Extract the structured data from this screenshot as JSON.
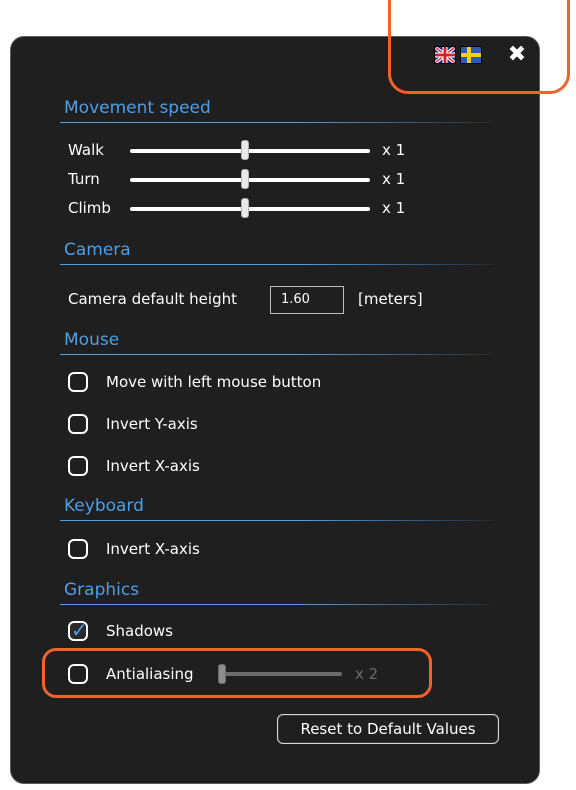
{
  "header": {
    "flags": [
      {
        "name": "uk-flag-icon",
        "language": "English"
      },
      {
        "name": "swedish-flag-icon",
        "language": "Swedish"
      }
    ],
    "close_icon": "close-icon",
    "close_glyph": "✖"
  },
  "sections": {
    "movement": {
      "title": "Movement speed",
      "rows": [
        {
          "label": "Walk",
          "multiplier": "x 1",
          "value_fraction": 0.48
        },
        {
          "label": "Turn",
          "multiplier": "x 1",
          "value_fraction": 0.48
        },
        {
          "label": "Climb",
          "multiplier": "x 1",
          "value_fraction": 0.48
        }
      ]
    },
    "camera": {
      "title": "Camera",
      "height_label": "Camera default height",
      "height_value": "1.60",
      "height_unit": "[meters]"
    },
    "mouse": {
      "title": "Mouse",
      "options": [
        {
          "label": "Move with left mouse button",
          "checked": false
        },
        {
          "label": "Invert Y-axis",
          "checked": false
        },
        {
          "label": "Invert X-axis",
          "checked": false
        }
      ]
    },
    "keyboard": {
      "title": "Keyboard",
      "options": [
        {
          "label": "Invert X-axis",
          "checked": false
        }
      ]
    },
    "graphics": {
      "title": "Graphics",
      "shadows": {
        "label": "Shadows",
        "checked": true
      },
      "antialiasing": {
        "label": "Antialiasing",
        "checked": false,
        "multiplier": "x 2",
        "value_fraction": 0.0,
        "enabled": false
      }
    }
  },
  "reset_button": "Reset to Default Values",
  "colors": {
    "panel_bg": "#1f1f1f",
    "section_title": "#4d9fe8",
    "highlight": "#f0632a",
    "checkmark": "#4d9fe8"
  }
}
